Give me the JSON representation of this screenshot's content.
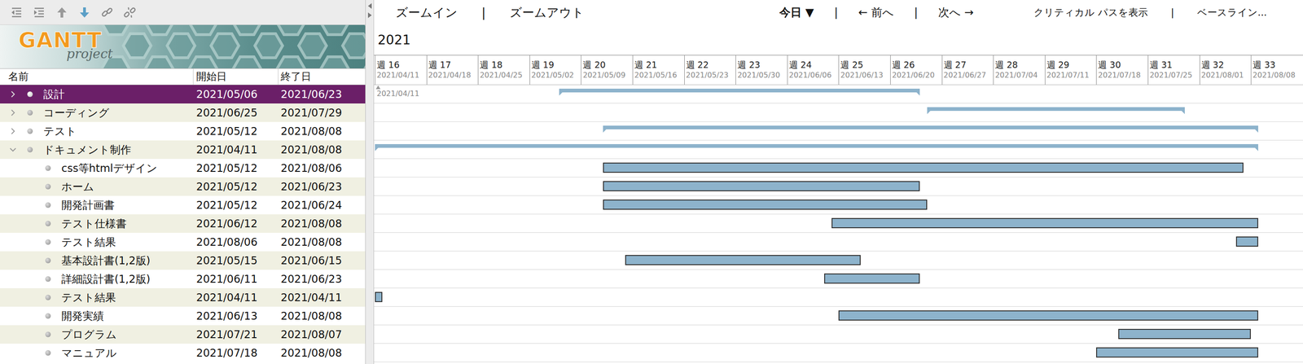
{
  "logo": {
    "title": "GANTT",
    "subtitle": "project"
  },
  "table": {
    "columns": [
      "名前",
      "開始日",
      "終了日"
    ],
    "rows": [
      {
        "name": "設計",
        "start": "2021/05/06",
        "end": "2021/06/23",
        "kind": "summary",
        "expanded": false,
        "selected": true
      },
      {
        "name": "コーディング",
        "start": "2021/06/25",
        "end": "2021/07/29",
        "kind": "summary",
        "expanded": false,
        "selected": false
      },
      {
        "name": "テスト",
        "start": "2021/05/12",
        "end": "2021/08/08",
        "kind": "summary",
        "expanded": false,
        "selected": false
      },
      {
        "name": "ドキュメント制作",
        "start": "2021/04/11",
        "end": "2021/08/08",
        "kind": "summary",
        "expanded": true,
        "selected": false
      },
      {
        "name": "css等htmlデザイン",
        "start": "2021/05/12",
        "end": "2021/08/06",
        "kind": "task",
        "selected": false
      },
      {
        "name": "ホーム",
        "start": "2021/05/12",
        "end": "2021/06/23",
        "kind": "task",
        "selected": false
      },
      {
        "name": "開発計画書",
        "start": "2021/05/12",
        "end": "2021/06/24",
        "kind": "task",
        "selected": false
      },
      {
        "name": "テスト仕様書",
        "start": "2021/06/12",
        "end": "2021/08/08",
        "kind": "task",
        "selected": false
      },
      {
        "name": "テスト結果",
        "start": "2021/08/06",
        "end": "2021/08/08",
        "kind": "task",
        "selected": false
      },
      {
        "name": "基本設計書(1,2版)",
        "start": "2021/05/15",
        "end": "2021/06/15",
        "kind": "task",
        "selected": false
      },
      {
        "name": "詳細設計書(1,2版)",
        "start": "2021/06/11",
        "end": "2021/06/23",
        "kind": "task",
        "selected": false
      },
      {
        "name": "テスト結果",
        "start": "2021/04/11",
        "end": "2021/04/11",
        "kind": "task",
        "selected": false
      },
      {
        "name": "開発実績",
        "start": "2021/06/13",
        "end": "2021/08/08",
        "kind": "task",
        "selected": false
      },
      {
        "name": "プログラム",
        "start": "2021/07/21",
        "end": "2021/08/07",
        "kind": "task",
        "selected": false
      },
      {
        "name": "マニュアル",
        "start": "2021/07/18",
        "end": "2021/08/08",
        "kind": "task",
        "selected": false
      }
    ]
  },
  "chart": {
    "toolbar_groups": [
      [
        "ズームイン",
        "|",
        "ズームアウト"
      ],
      [
        "今日 ▼",
        "|",
        "← 前へ",
        "|",
        "次へ →"
      ],
      [
        "クリティカル パスを表示",
        "|",
        "ベースライン..."
      ]
    ],
    "year": "2021",
    "start_marker": "2021/04/11",
    "weeks": [
      {
        "label": "週 16",
        "date": "2021/04/11"
      },
      {
        "label": "週 17",
        "date": "2021/04/18"
      },
      {
        "label": "週 18",
        "date": "2021/04/25"
      },
      {
        "label": "週 19",
        "date": "2021/05/02"
      },
      {
        "label": "週 20",
        "date": "2021/05/09"
      },
      {
        "label": "週 21",
        "date": "2021/05/16"
      },
      {
        "label": "週 22",
        "date": "2021/05/23"
      },
      {
        "label": "週 23",
        "date": "2021/05/30"
      },
      {
        "label": "週 24",
        "date": "2021/06/06"
      },
      {
        "label": "週 25",
        "date": "2021/06/13"
      },
      {
        "label": "週 26",
        "date": "2021/06/20"
      },
      {
        "label": "週 27",
        "date": "2021/06/27"
      },
      {
        "label": "週 28",
        "date": "2021/07/04"
      },
      {
        "label": "週 29",
        "date": "2021/07/11"
      },
      {
        "label": "週 30",
        "date": "2021/07/18"
      },
      {
        "label": "週 31",
        "date": "2021/07/25"
      },
      {
        "label": "週 32",
        "date": "2021/08/01"
      },
      {
        "label": "週 33",
        "date": "2021/08/08"
      }
    ]
  }
}
